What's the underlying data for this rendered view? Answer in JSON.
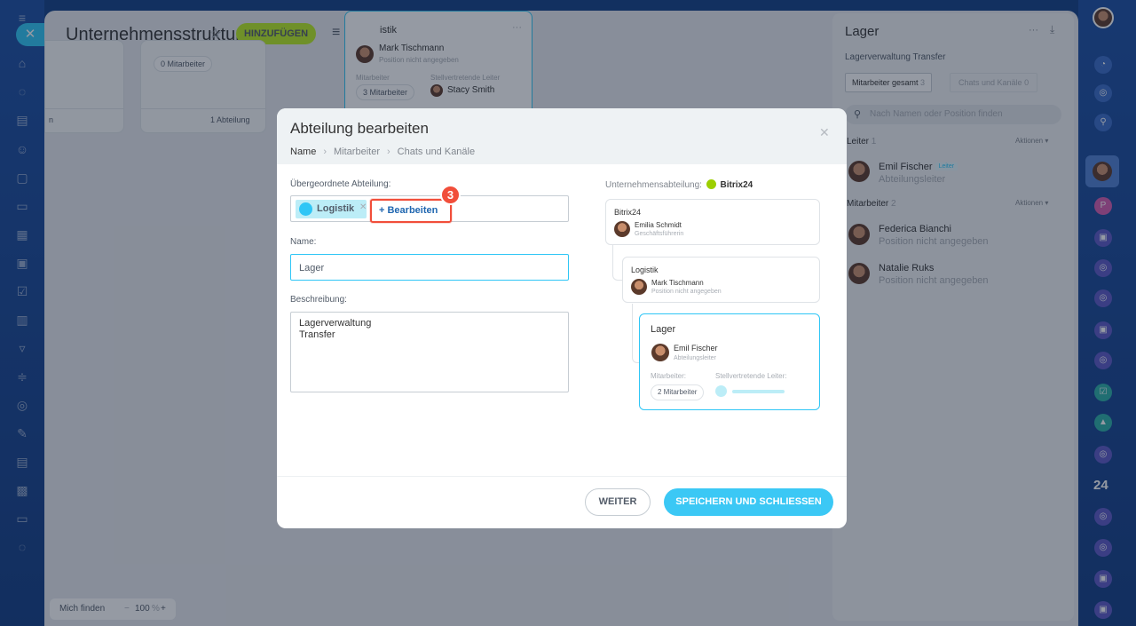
{
  "header": {
    "title": "Unternehmensstruktur",
    "add_label": "HINZUFÜGEN"
  },
  "background_cards": {
    "card1_badge": "0 Mitarbeiter",
    "card1_footer": "1 Abteilung",
    "card0_footer": "n",
    "logistik_title": "istik",
    "logistik_person": "Mark Tischmann",
    "logistik_position": "Position nicht angegeben",
    "logistik_employees_label": "Mitarbeiter",
    "logistik_deputy_label": "Stellvertretende Leiter",
    "logistik_employees_badge": "3 Mitarbeiter",
    "logistik_deputy_name": "Stacy Smith"
  },
  "right_panel": {
    "title": "Lager",
    "description": "Lagerverwaltung Transfer",
    "tab_employees": "Mitarbeiter gesamt",
    "tab_employees_count": "3",
    "tab_chats": "Chats und Kanäle",
    "tab_chats_count": "0",
    "search_placeholder": "Nach Namen oder Position finden",
    "leader_section": "Leiter",
    "leader_count": "1",
    "employees_section": "Mitarbeiter",
    "employees_count": "2",
    "actions_label": "Aktionen",
    "people": [
      {
        "name": "Emil Fischer",
        "badge": "Leiter",
        "role": "Abteilungsleiter"
      },
      {
        "name": "Federica Bianchi",
        "role": "Position nicht angegeben"
      },
      {
        "name": "Natalie Ruks",
        "role": "Position nicht angegeben"
      }
    ]
  },
  "modal": {
    "title": "Abteilung bearbeiten",
    "breadcrumbs": [
      "Name",
      "Mitarbeiter",
      "Chats und Kanäle"
    ],
    "parent_label": "Übergeordnete Abteilung:",
    "parent_tag": "Logistik",
    "edit_button": "+ Bearbeiten",
    "step_number": "3",
    "name_label": "Name:",
    "name_value": "Lager",
    "description_label": "Beschreibung:",
    "description_lines": [
      "Lagerverwaltung",
      "Transfer"
    ],
    "tree_label": "Unternehmensabteilung:",
    "tree_company": "Bitrix24",
    "tree": {
      "root_title": "Bitrix24",
      "root_person": "Emilia Schmidt",
      "root_role": "Geschäftsführerin",
      "mid_title": "Logistik",
      "mid_person": "Mark Tischmann",
      "mid_role": "Position nicht angegeben",
      "leaf_title": "Lager",
      "leaf_person": "Emil Fischer",
      "leaf_role": "Abteilungsleiter",
      "leaf_employees_label": "Mitarbeiter:",
      "leaf_deputy_label": "Stellvertretende Leiter:",
      "leaf_employees_badge": "2 Mitarbeiter"
    },
    "next_button": "WEITER",
    "save_button": "SPEICHERN UND SCHLIESSEN"
  },
  "bottom_bar": {
    "find_me": "Mich finden",
    "zoom": "100",
    "zoom_unit": "%"
  },
  "right_rail": {
    "badge_24": "24"
  }
}
